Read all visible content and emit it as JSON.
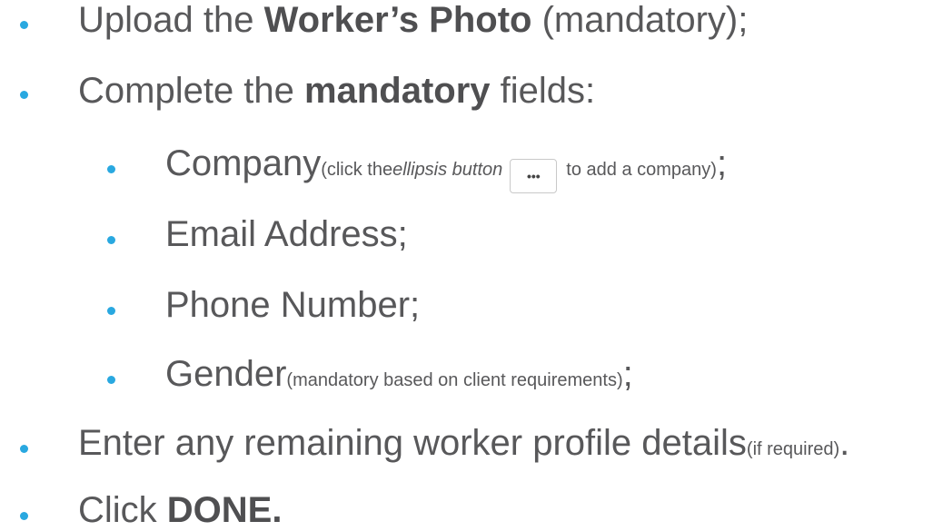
{
  "items": [
    {
      "level": 1,
      "pre": "Upload the ",
      "bold": "Worker’s Photo",
      "post": " (mandatory);"
    },
    {
      "level": 1,
      "pre": "Complete the ",
      "bold": "mandatory",
      "post": " fields:"
    },
    {
      "level": 2,
      "main": "Company",
      "note_pre": " (click the ",
      "note_em": "ellipsis button",
      "button_icon": "ellipsis-icon",
      "button_glyph": "•••",
      "note_post": "to add a company)",
      "end": ";"
    },
    {
      "level": 2,
      "main": "Email Address;"
    },
    {
      "level": 2,
      "main": "Phone Number;"
    },
    {
      "level": 2,
      "main": "Gender",
      "note": " (mandatory based on client requirements)",
      "end": ";"
    },
    {
      "level": 1,
      "main": "Enter any remaining worker profile details",
      "note": " (if required)",
      "end": "."
    },
    {
      "level": 1,
      "pre": "Click ",
      "bold": "DONE."
    }
  ],
  "colors": {
    "bullet": "#29a8e0",
    "text": "#58585a"
  }
}
